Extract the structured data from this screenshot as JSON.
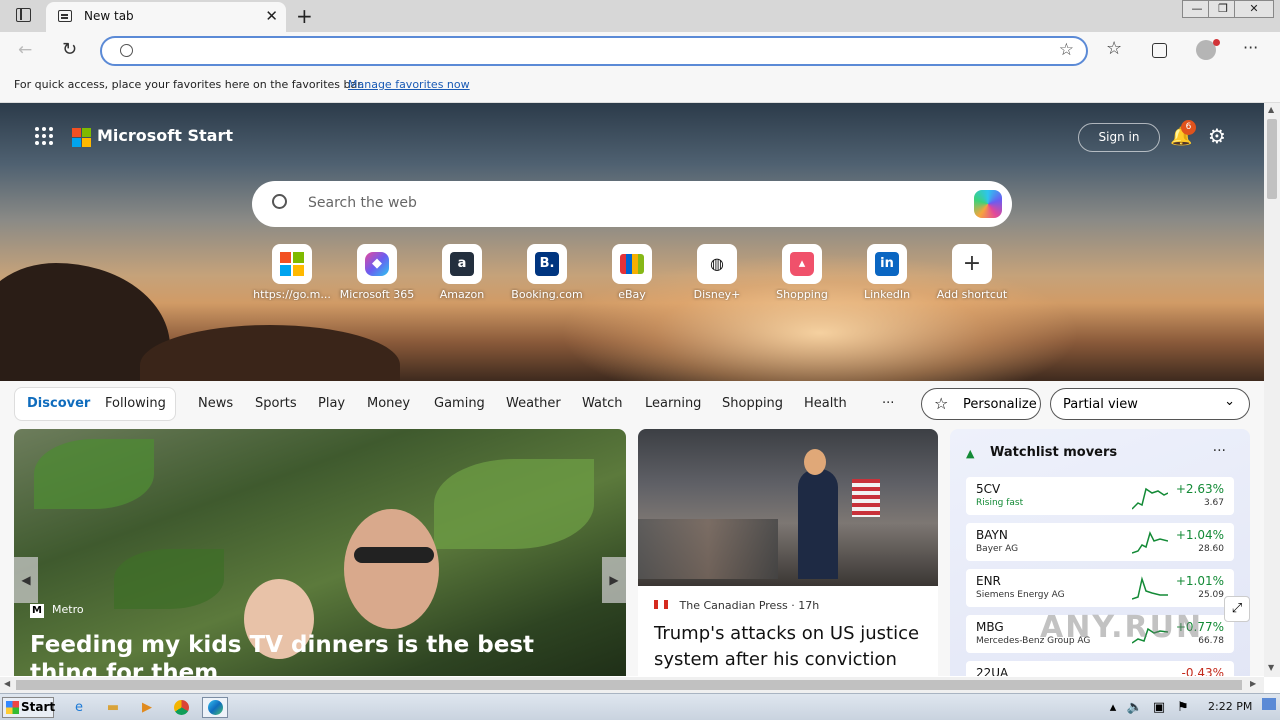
{
  "browser": {
    "tab_title": "New tab",
    "address_value": "",
    "favorites_bar_text": "For quick access, place your favorites here on the favorites bar.",
    "favorites_bar_link": "Manage favorites now"
  },
  "header": {
    "brand": "Microsoft Start",
    "sign_in": "Sign in",
    "notification_count": "6"
  },
  "search": {
    "placeholder": "Search the web"
  },
  "shortcuts": [
    {
      "label": "https://go.m...",
      "icon": "microsoft-logo-icon"
    },
    {
      "label": "Microsoft 365",
      "icon": "microsoft-365-icon"
    },
    {
      "label": "Amazon",
      "icon": "amazon-icon"
    },
    {
      "label": "Booking.com",
      "icon": "booking-icon"
    },
    {
      "label": "eBay",
      "icon": "ebay-icon"
    },
    {
      "label": "Disney+",
      "icon": "disney-icon"
    },
    {
      "label": "Shopping",
      "icon": "shopping-bag-icon"
    },
    {
      "label": "LinkedIn",
      "icon": "linkedin-icon"
    },
    {
      "label": "Add shortcut",
      "icon": "plus-icon"
    }
  ],
  "nav": {
    "pill": [
      "Discover",
      "Following"
    ],
    "items": [
      "News",
      "Sports",
      "Play",
      "Money",
      "Gaming",
      "Weather",
      "Watch",
      "Learning",
      "Shopping",
      "Health"
    ],
    "more": "···",
    "personalize": "Personalize",
    "view_select": "Partial view"
  },
  "feature": {
    "source": "Metro",
    "headline": "Feeding my kids TV dinners is the best thing for them"
  },
  "secondary": {
    "source": "The Canadian Press",
    "age": "17h",
    "headline": "Trump's attacks on US justice system after his conviction"
  },
  "watchlist": {
    "title": "Watchlist movers",
    "items": [
      {
        "symbol": "5CV",
        "name": "Rising fast",
        "change": "+2.63%",
        "price": "3.67"
      },
      {
        "symbol": "BAYN",
        "name": "Bayer AG",
        "change": "+1.04%",
        "price": "28.60"
      },
      {
        "symbol": "ENR",
        "name": "Siemens Energy AG",
        "change": "+1.01%",
        "price": "25.09"
      },
      {
        "symbol": "MBG",
        "name": "Mercedes-Benz Group AG",
        "change": "+0.77%",
        "price": "66.78"
      },
      {
        "symbol": "22UA",
        "name": "",
        "change": "-0.43%",
        "price": ""
      }
    ]
  },
  "taskbar": {
    "start": "Start",
    "time": "2:22 PM"
  },
  "watermark": "ANY.RUN",
  "colors": {
    "accent": "#0f6cbd",
    "positive": "#138a36",
    "negative": "#c42b1c"
  }
}
